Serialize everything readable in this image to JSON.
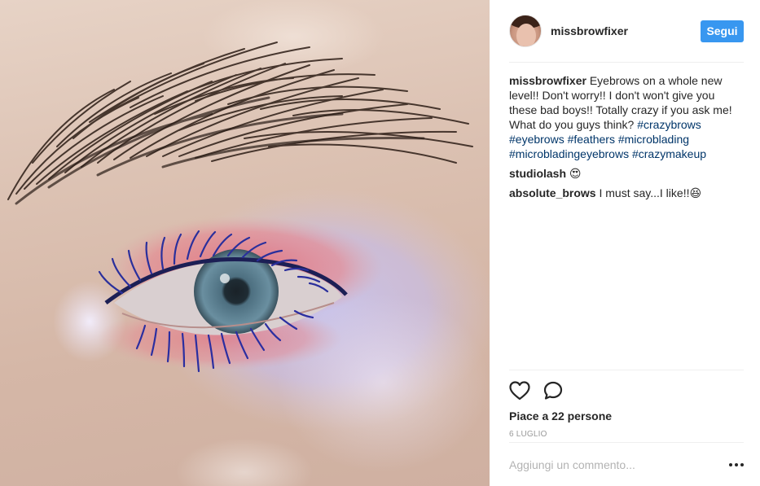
{
  "post": {
    "image_alt": "Close-up of an eye with feathered eyebrow, pink and lilac eyeshadow and blue mascara",
    "header": {
      "username": "missbrowfixer",
      "follow_label": "Segui"
    },
    "caption": {
      "username": "missbrowfixer",
      "text": "Eyebrows on a whole new level!! Don't worry!! I don't won't give you these bad boys!! Totally crazy if you ask me! What do you guys think?",
      "hashtags": [
        "#crazybrows",
        "#eyebrows",
        "#feathers",
        "#microblading",
        "#microbladingeyebrows",
        "#crazymakeup"
      ]
    },
    "comments": [
      {
        "username": "studiolash",
        "text": "😍"
      },
      {
        "username": "absolute_brows",
        "text": "I must say...I like!!😆"
      }
    ],
    "likes_text": "Piace a 22 persone",
    "date": "6 luglio",
    "comment_placeholder": "Aggiungi un commento...",
    "icons": {
      "like": "heart-icon",
      "comment": "comment-bubble-icon",
      "more": "more-options-icon"
    },
    "colors": {
      "accent": "#3897f0",
      "hashtag": "#003569",
      "divider": "#efefef"
    }
  }
}
